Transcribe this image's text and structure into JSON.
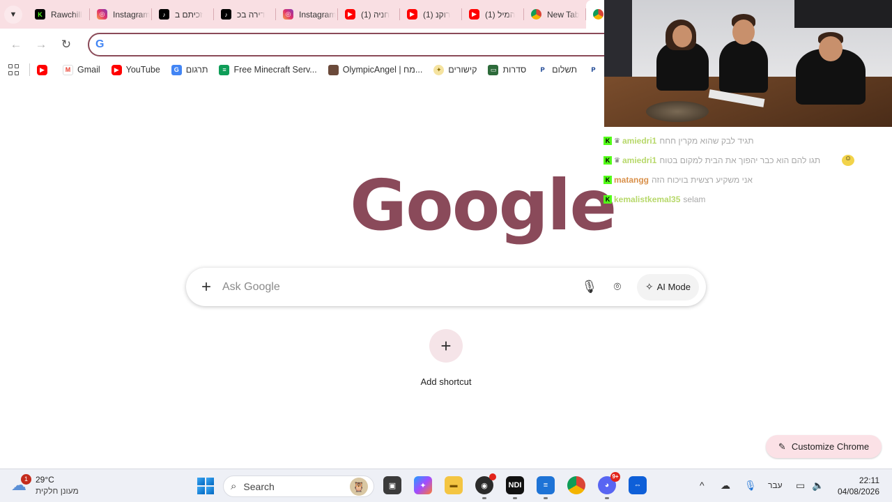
{
  "tabs": [
    {
      "title": "Rawchill",
      "icon": "kick-icon",
      "letter": "K"
    },
    {
      "title": "Instagram",
      "icon": "instagram-icon",
      "letter": "◎"
    },
    {
      "title": "זכיתם ב",
      "icon": "tiktok-icon",
      "letter": "♪"
    },
    {
      "title": "דירה בכ",
      "icon": "tiktok-icon",
      "letter": "♪"
    },
    {
      "title": "Instagram",
      "icon": "instagram-icon",
      "letter": "◎"
    },
    {
      "title": "(1) חניה",
      "icon": "youtube-icon",
      "letter": "▶"
    },
    {
      "title": "(1) רוקנ",
      "icon": "youtube-icon",
      "letter": "▶"
    },
    {
      "title": "(1) המיל",
      "icon": "youtube-icon",
      "letter": "▶"
    },
    {
      "title": "New Tab",
      "icon": "chrome-icon",
      "letter": ""
    },
    {
      "title": "",
      "icon": "chrome-icon",
      "letter": ""
    }
  ],
  "bookmarks": [
    {
      "label": "",
      "icon": "youtube-icon",
      "cls": "yt",
      "letter": "▶"
    },
    {
      "label": "Gmail",
      "icon": "gmail-icon",
      "cls": "gmail",
      "letter": "M"
    },
    {
      "label": "YouTube",
      "icon": "youtube-icon",
      "cls": "yt",
      "letter": "▶"
    },
    {
      "label": "תרגום",
      "icon": "google-translate-icon",
      "cls": "g",
      "letter": "G"
    },
    {
      "label": "Free Minecraft Serv...",
      "icon": "sheets-icon",
      "cls": "sheet",
      "letter": "≡"
    },
    {
      "label": "OlympicAngel | מח...",
      "icon": "profile-image-icon",
      "cls": "img",
      "letter": ""
    },
    {
      "label": "קישורים",
      "icon": "bulb-icon",
      "cls": "light",
      "letter": "✦"
    },
    {
      "label": "סדרות",
      "icon": "tv-icon",
      "cls": "tv",
      "letter": "▭"
    },
    {
      "label": "תשלום",
      "icon": "paypal-icon",
      "cls": "pp",
      "letter": "P"
    },
    {
      "label": "",
      "icon": "paypal-icon",
      "cls": "pp",
      "letter": "P"
    }
  ],
  "ntp": {
    "logo": "Google",
    "search_placeholder": "Ask Google",
    "ai_mode_label": "AI Mode",
    "add_shortcut_label": "Add shortcut",
    "customize_label": "Customize Chrome"
  },
  "chat": [
    {
      "user": "amiedri1",
      "user_color": "#b7d86a",
      "sub": true,
      "message": "תגיד לבק שהוא מקרין חחח",
      "emote": false
    },
    {
      "user": "amiedri1",
      "user_color": "#b7d86a",
      "sub": true,
      "message": "תגו להם הוא כבר יהפוך את הבית למקום בטוח",
      "emote": true
    },
    {
      "user": "matangg",
      "user_color": "#d9904a",
      "sub": false,
      "message": "אני משקיע רצשית בויכוח הזה",
      "emote": false
    },
    {
      "user": "kemalistkemal35",
      "user_color": "#b7d86a",
      "sub": false,
      "message": "selam",
      "emote": false
    }
  ],
  "taskbar": {
    "weather_temp": "29°C",
    "weather_desc": "מעונן חלקית",
    "weather_badge": "1",
    "search_label": "Search",
    "language": "עבר",
    "time": "22:11",
    "date": "04/08/2026",
    "discord_badge": "9+"
  }
}
